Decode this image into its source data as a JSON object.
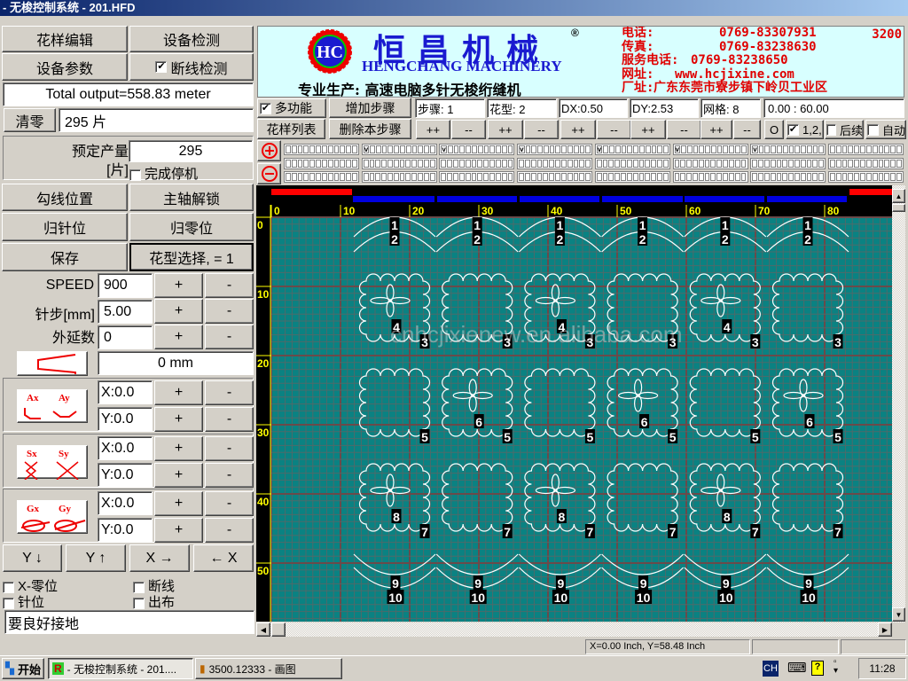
{
  "window": {
    "title": "- 无梭控制系统 - 201.HFD"
  },
  "left": {
    "pattern_edit": "花样编辑",
    "device_test": "设备检测",
    "device_params": "设备参数",
    "break_detect": {
      "label": "断线检测",
      "checked": true
    },
    "total_output": "Total output=558.83 meter",
    "clear": "清零",
    "count": "295 片",
    "preset_label1": "预定产量",
    "preset_label2": "[片]",
    "preset_value": "295",
    "finish_stop": {
      "label": "完成停机",
      "checked": false
    },
    "hook_pos": "勾线位置",
    "spindle_unlock": "主轴解锁",
    "needle_home": "归针位",
    "zero_home": "归零位",
    "save": "保存",
    "pattern_select": "花型选择, = 1",
    "speed": {
      "label": "SPEED",
      "value": "900"
    },
    "stitch": {
      "label": "针步[mm]",
      "value": "5.00"
    },
    "extend": {
      "label": "外延数",
      "value": "0"
    },
    "plus": "+",
    "minus": "-",
    "offset_value": "0 mm",
    "a_group": {
      "icon_x": "Ax",
      "icon_y": "Ay",
      "x": "X:0.0",
      "y": "Y:0.0"
    },
    "s_group": {
      "icon_x": "Sx",
      "icon_y": "Sy",
      "x": "X:0.0",
      "y": "Y:0.0"
    },
    "g_group": {
      "icon_x": "Gx",
      "icon_y": "Gy",
      "x": "X:0.0",
      "y": "Y:0.0"
    },
    "dir": {
      "y_down": "Y ↓",
      "y_up": "Y ↑",
      "x_right": "X →",
      "x_left": "← X"
    },
    "checks": {
      "x_zero": {
        "label": "X-零位",
        "checked": false
      },
      "needle": {
        "label": "针位",
        "checked": false
      },
      "break": {
        "label": "断线",
        "checked": false
      },
      "cloth_out": {
        "label": "出布",
        "checked": false
      }
    },
    "message": "要良好接地"
  },
  "header": {
    "brand_cn": "恒昌机械",
    "registered": "®",
    "brand_en": "HENGCHANG MACHINERY",
    "logo_text": "HC",
    "slogan": "专业生产: 高速电脑多针无梭绗缝机",
    "contacts": [
      {
        "label": "电话:",
        "value": "0769-83307931"
      },
      {
        "label": "传真:",
        "value": "0769-83238630"
      },
      {
        "label": "服务电话:",
        "value": "0769-83238650"
      },
      {
        "label": "网址:",
        "value": "www.hcjixine.com"
      },
      {
        "label": "厂址:",
        "value": "广东东莞市寮步镇下岭贝工业区"
      }
    ],
    "code": "3200"
  },
  "toolbar": {
    "multi": {
      "label": "多功能",
      "checked": true
    },
    "add_step": "增加步骤",
    "pattern_list": "花样列表",
    "delete_step": "删除本步骤",
    "step": "步骤: 1",
    "pattern": "花型: 2",
    "dx": "DX:0.50",
    "dy": "DY:2.53",
    "grid": "网格: 8",
    "range": "0.00 : 60.00",
    "inc": "++",
    "dec": "--",
    "o": "O",
    "opt12": {
      "label": "1,2,",
      "checked": true
    },
    "follow": {
      "label": "后续",
      "checked": false
    },
    "auto": {
      "label": "自动",
      "checked": false
    }
  },
  "needle_strip": {
    "groups": 8,
    "rows": 3,
    "boxes": 12,
    "checked_first_row": [
      false,
      true,
      true,
      true,
      true,
      true,
      true,
      false
    ],
    "mark": "v"
  },
  "canvas": {
    "x_ticks": [
      "0",
      "10",
      "20",
      "30",
      "40",
      "50",
      "60",
      "70",
      "80"
    ],
    "y_ticks": [
      "0",
      "10",
      "20",
      "30",
      "40",
      "50"
    ],
    "top_arc_labels": [
      "1",
      "2"
    ],
    "bottom_arc_labels": [
      "9",
      "10"
    ],
    "columns": 6,
    "rows": [
      {
        "flower_cols": [
          0,
          2,
          4
        ],
        "flower_label": "4",
        "square_label": "3"
      },
      {
        "flower_cols": [
          1,
          3,
          5
        ],
        "flower_label": "6",
        "square_label": "5"
      },
      {
        "flower_cols": [
          0,
          2,
          4
        ],
        "flower_label": "8",
        "square_label": "7"
      }
    ],
    "watermark": "cnhcjixienew.en.alibaba.com",
    "colors": {
      "bg": "#0a8282",
      "grid": "#4e6a6a",
      "major": "#6a4a4a",
      "stitch": "#ffffff",
      "ruler": "#000000",
      "ruler_text": "#ffff00"
    }
  },
  "status": {
    "coords": "X=0.00 Inch, Y=58.48 Inch"
  },
  "taskbar": {
    "start": "开始",
    "task1": "- 无梭控制系统 - 201....",
    "task2": "3500.12333 - 画图",
    "lang": "CH",
    "time": "11:28"
  }
}
